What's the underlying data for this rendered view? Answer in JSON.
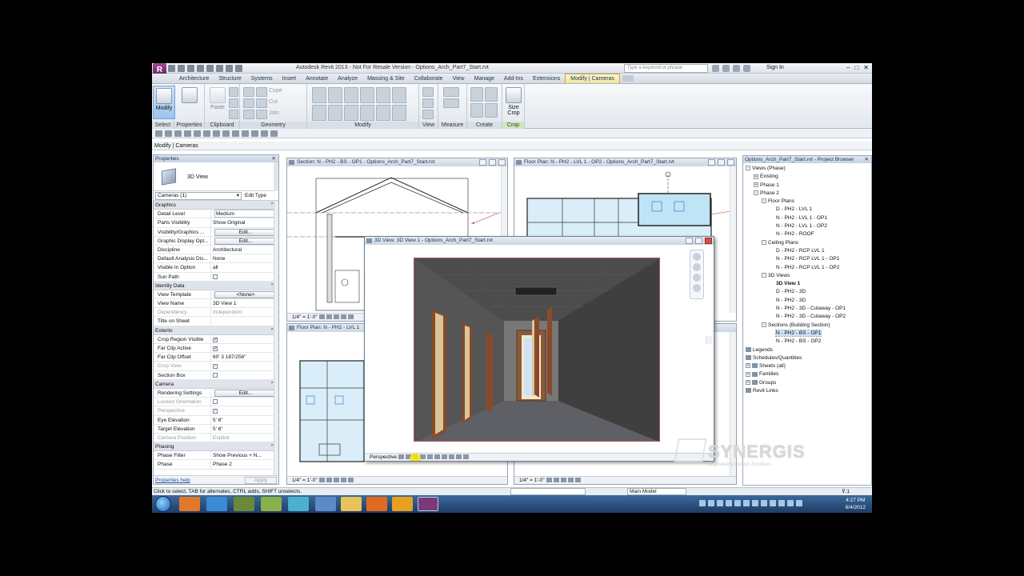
{
  "window": {
    "title": "Autodesk Revit 2013 -  Not For Resale Version -     Options_Arch_Part7_Start.rvt",
    "search_placeholder": "Type a keyword or phrase",
    "sign_in": "Sign In"
  },
  "ribbon_tabs": [
    "Architecture",
    "Structure",
    "Systems",
    "Insert",
    "Annotate",
    "Analyze",
    "Massing & Site",
    "Collaborate",
    "View",
    "Manage",
    "Add-Ins",
    "Extensions",
    "Modify | Cameras"
  ],
  "ribbon": {
    "modify_label": "Modify",
    "properties_label": "Properties",
    "panels": [
      "Select",
      "Properties",
      "Clipboard",
      "Geometry",
      "Modify",
      "View",
      "Measure",
      "Create",
      "Crop"
    ],
    "clipboard": {
      "paste": "Paste",
      "cope": "Cope",
      "cut": "Cut",
      "join": "Join"
    },
    "size_crop": "Size Crop"
  },
  "context_bar": "Modify | Cameras",
  "properties": {
    "title": "Properties",
    "type_name": "3D View",
    "instance": "Cameras (1)",
    "edit_type": "Edit Type",
    "groups": {
      "graphics": "Graphics",
      "identity": "Identity Data",
      "extents": "Extents",
      "camera": "Camera",
      "phasing": "Phasing"
    },
    "rows": {
      "detail_level": [
        "Detail Level",
        "Medium"
      ],
      "parts_visibility": [
        "Parts Visibility",
        "Show Original"
      ],
      "vg": [
        "Visibility/Graphics ...",
        "Edit..."
      ],
      "gdo": [
        "Graphic Display Opt...",
        "Edit..."
      ],
      "discipline": [
        "Discipline",
        "Architectural"
      ],
      "default_analysis": [
        "Default Analysis Dis...",
        "None"
      ],
      "visible_in_option": [
        "Visible In Option",
        "all"
      ],
      "sun_path": [
        "Sun Path",
        ""
      ],
      "view_template": [
        "View Template",
        "<None>"
      ],
      "view_name": [
        "View Name",
        "3D View 1"
      ],
      "dependency": [
        "Dependency",
        "Independent"
      ],
      "title_on_sheet": [
        "Title on Sheet",
        ""
      ],
      "crop_region_visible": [
        "Crop Region Visible",
        ""
      ],
      "far_clip_active": [
        "Far Clip Active",
        ""
      ],
      "far_clip_offset": [
        "Far Clip Offset",
        "60'  3 187/256\""
      ],
      "crop_view": [
        "Crop View",
        ""
      ],
      "section_box": [
        "Section Box",
        ""
      ],
      "rendering_settings": [
        "Rendering Settings",
        "Edit..."
      ],
      "locked_orientation": [
        "Locked Orientation",
        ""
      ],
      "perspective": [
        "Perspective",
        ""
      ],
      "eye_elevation": [
        "Eye Elevation",
        "5'  6\""
      ],
      "target_elevation": [
        "Target Elevation",
        "5'  6\""
      ],
      "camera_position": [
        "Camera Position",
        "Explicit"
      ],
      "phase_filter": [
        "Phase Filter",
        "Show Previous + N..."
      ],
      "phase": [
        "Phase",
        "Phase 2"
      ]
    },
    "help_link": "Properties help",
    "apply": "Apply"
  },
  "views": {
    "section": {
      "title": "Section: N - PH2 - BS - OP1 - Options_Arch_Part7_Start.rvt",
      "scale": "1/4\" = 1'-0\""
    },
    "floor_plan_op2": {
      "title": "Floor Plan: N - PH2 - LVL 1 - OP2 - Options_Arch_Part7_Start.rvt",
      "scale": "1/4\" = 1'-0\""
    },
    "floor_plan_lvl1": {
      "title": "Floor Plan: N - PH2 - LVL 1",
      "scale": "1/4\" = 1'-0\""
    },
    "view_3d": {
      "title": "3D View: 3D View 1 - Options_Arch_Part7_Start.rvt",
      "mode": "Perspective"
    },
    "bottom_right_scale": "1/4\" = 1'-0\""
  },
  "project_browser": {
    "title": "Options_Arch_Part7_Start.rvt - Project Browser",
    "items": [
      {
        "label": "Views (Phase)",
        "level": 0,
        "exp": "-"
      },
      {
        "label": "Existing",
        "level": 1,
        "exp": "+"
      },
      {
        "label": "Phase 1",
        "level": 1,
        "exp": "+"
      },
      {
        "label": "Phase 2",
        "level": 1,
        "exp": "-"
      },
      {
        "label": "Floor Plans",
        "level": 2,
        "exp": "-"
      },
      {
        "label": "D - PH2 - LVL 1",
        "level": 3
      },
      {
        "label": "N - PH2 - LVL 1 - OP1",
        "level": 3
      },
      {
        "label": "N - PH2 - LVL 1 - OP2",
        "level": 3
      },
      {
        "label": "N - PH2 - ROOF",
        "level": 3
      },
      {
        "label": "Ceiling Plans",
        "level": 2,
        "exp": "-"
      },
      {
        "label": "D - PH2 - RCP LVL 1",
        "level": 3
      },
      {
        "label": "N - PH2 - RCP LVL 1 - OP1",
        "level": 3
      },
      {
        "label": "N - PH2 - RCP LVL 1 - OP2",
        "level": 3
      },
      {
        "label": "3D Views",
        "level": 2,
        "exp": "-"
      },
      {
        "label": "3D View 1",
        "level": 3,
        "bold": true
      },
      {
        "label": "D - PH2 - 3D",
        "level": 3
      },
      {
        "label": "N - PH2 - 3D",
        "level": 3
      },
      {
        "label": "N - PH2 - 3D - Cutaway - OP1",
        "level": 3
      },
      {
        "label": "N - PH2 - 3D - Cutaway - OP2",
        "level": 3
      },
      {
        "label": "Sections (Building Section)",
        "level": 2,
        "exp": "-"
      },
      {
        "label": "N - PH2 - BS - OP1",
        "level": 3,
        "selected": true
      },
      {
        "label": "N - PH2 - BS - OP2",
        "level": 3
      },
      {
        "label": "Legends",
        "level": 0,
        "icon": true
      },
      {
        "label": "Schedules/Quantities",
        "level": 0,
        "icon": true
      },
      {
        "label": "Sheets (all)",
        "level": 0,
        "exp": "+",
        "icon": true
      },
      {
        "label": "Families",
        "level": 0,
        "exp": "+",
        "icon": true
      },
      {
        "label": "Groups",
        "level": 0,
        "exp": "+",
        "icon": true
      },
      {
        "label": "Revit Links",
        "level": 0,
        "icon": true
      }
    ]
  },
  "status": {
    "message": "Click to select, TAB for alternates, CTRL adds, SHIFT unselects.",
    "main_model": "Main Model",
    "filter_count": ":1"
  },
  "clock": {
    "time": "4:27 PM",
    "date": "6/4/2012"
  },
  "watermark": {
    "brand": "SYNERGIS",
    "tagline": "Engineering Design Solutions"
  },
  "colors": {
    "accent_tab": "#f0e39a",
    "crop_green": "#cfe7bd",
    "taskbar": "#2a4f7e"
  }
}
